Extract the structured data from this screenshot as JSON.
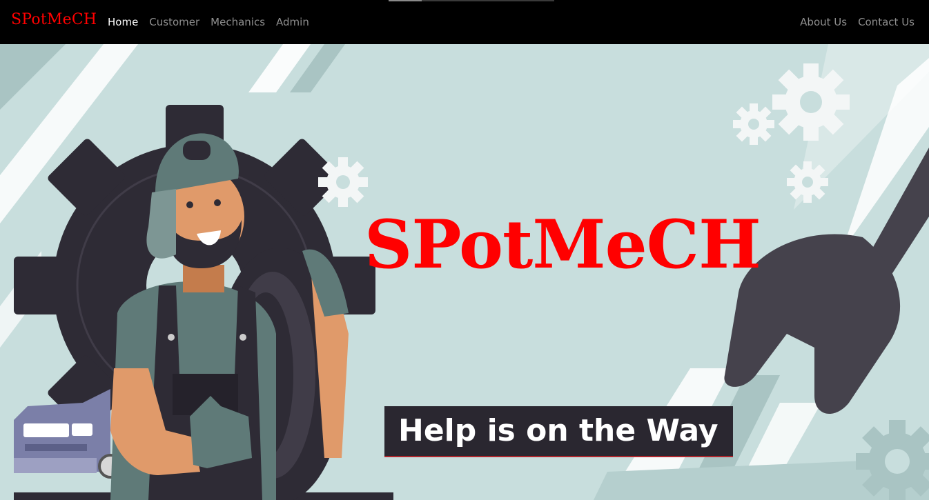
{
  "navbar": {
    "brand": "SPotMeCH",
    "left_links": [
      {
        "label": "Home",
        "active": true
      },
      {
        "label": "Customer",
        "active": false
      },
      {
        "label": "Mechanics",
        "active": false
      },
      {
        "label": "Admin",
        "active": false
      }
    ],
    "right_links": [
      {
        "label": "About Us"
      },
      {
        "label": "Contact Us"
      }
    ]
  },
  "hero": {
    "title": "SPotMeCH",
    "tagline": "Help is on the Way"
  },
  "colors": {
    "brand_red": "#ff0000",
    "nav_bg": "#000000",
    "nav_link": "#8f8f8f",
    "nav_link_active": "#ffffff",
    "hero_bg": "#c8dedd",
    "tagline_bg": "#2a2730",
    "dark_gear": "#2e2b35",
    "wrench": "#45424c"
  },
  "icons": [
    "gear-icon",
    "wrench-icon",
    "tire-icon",
    "car-icon",
    "mechanic-illustration"
  ]
}
